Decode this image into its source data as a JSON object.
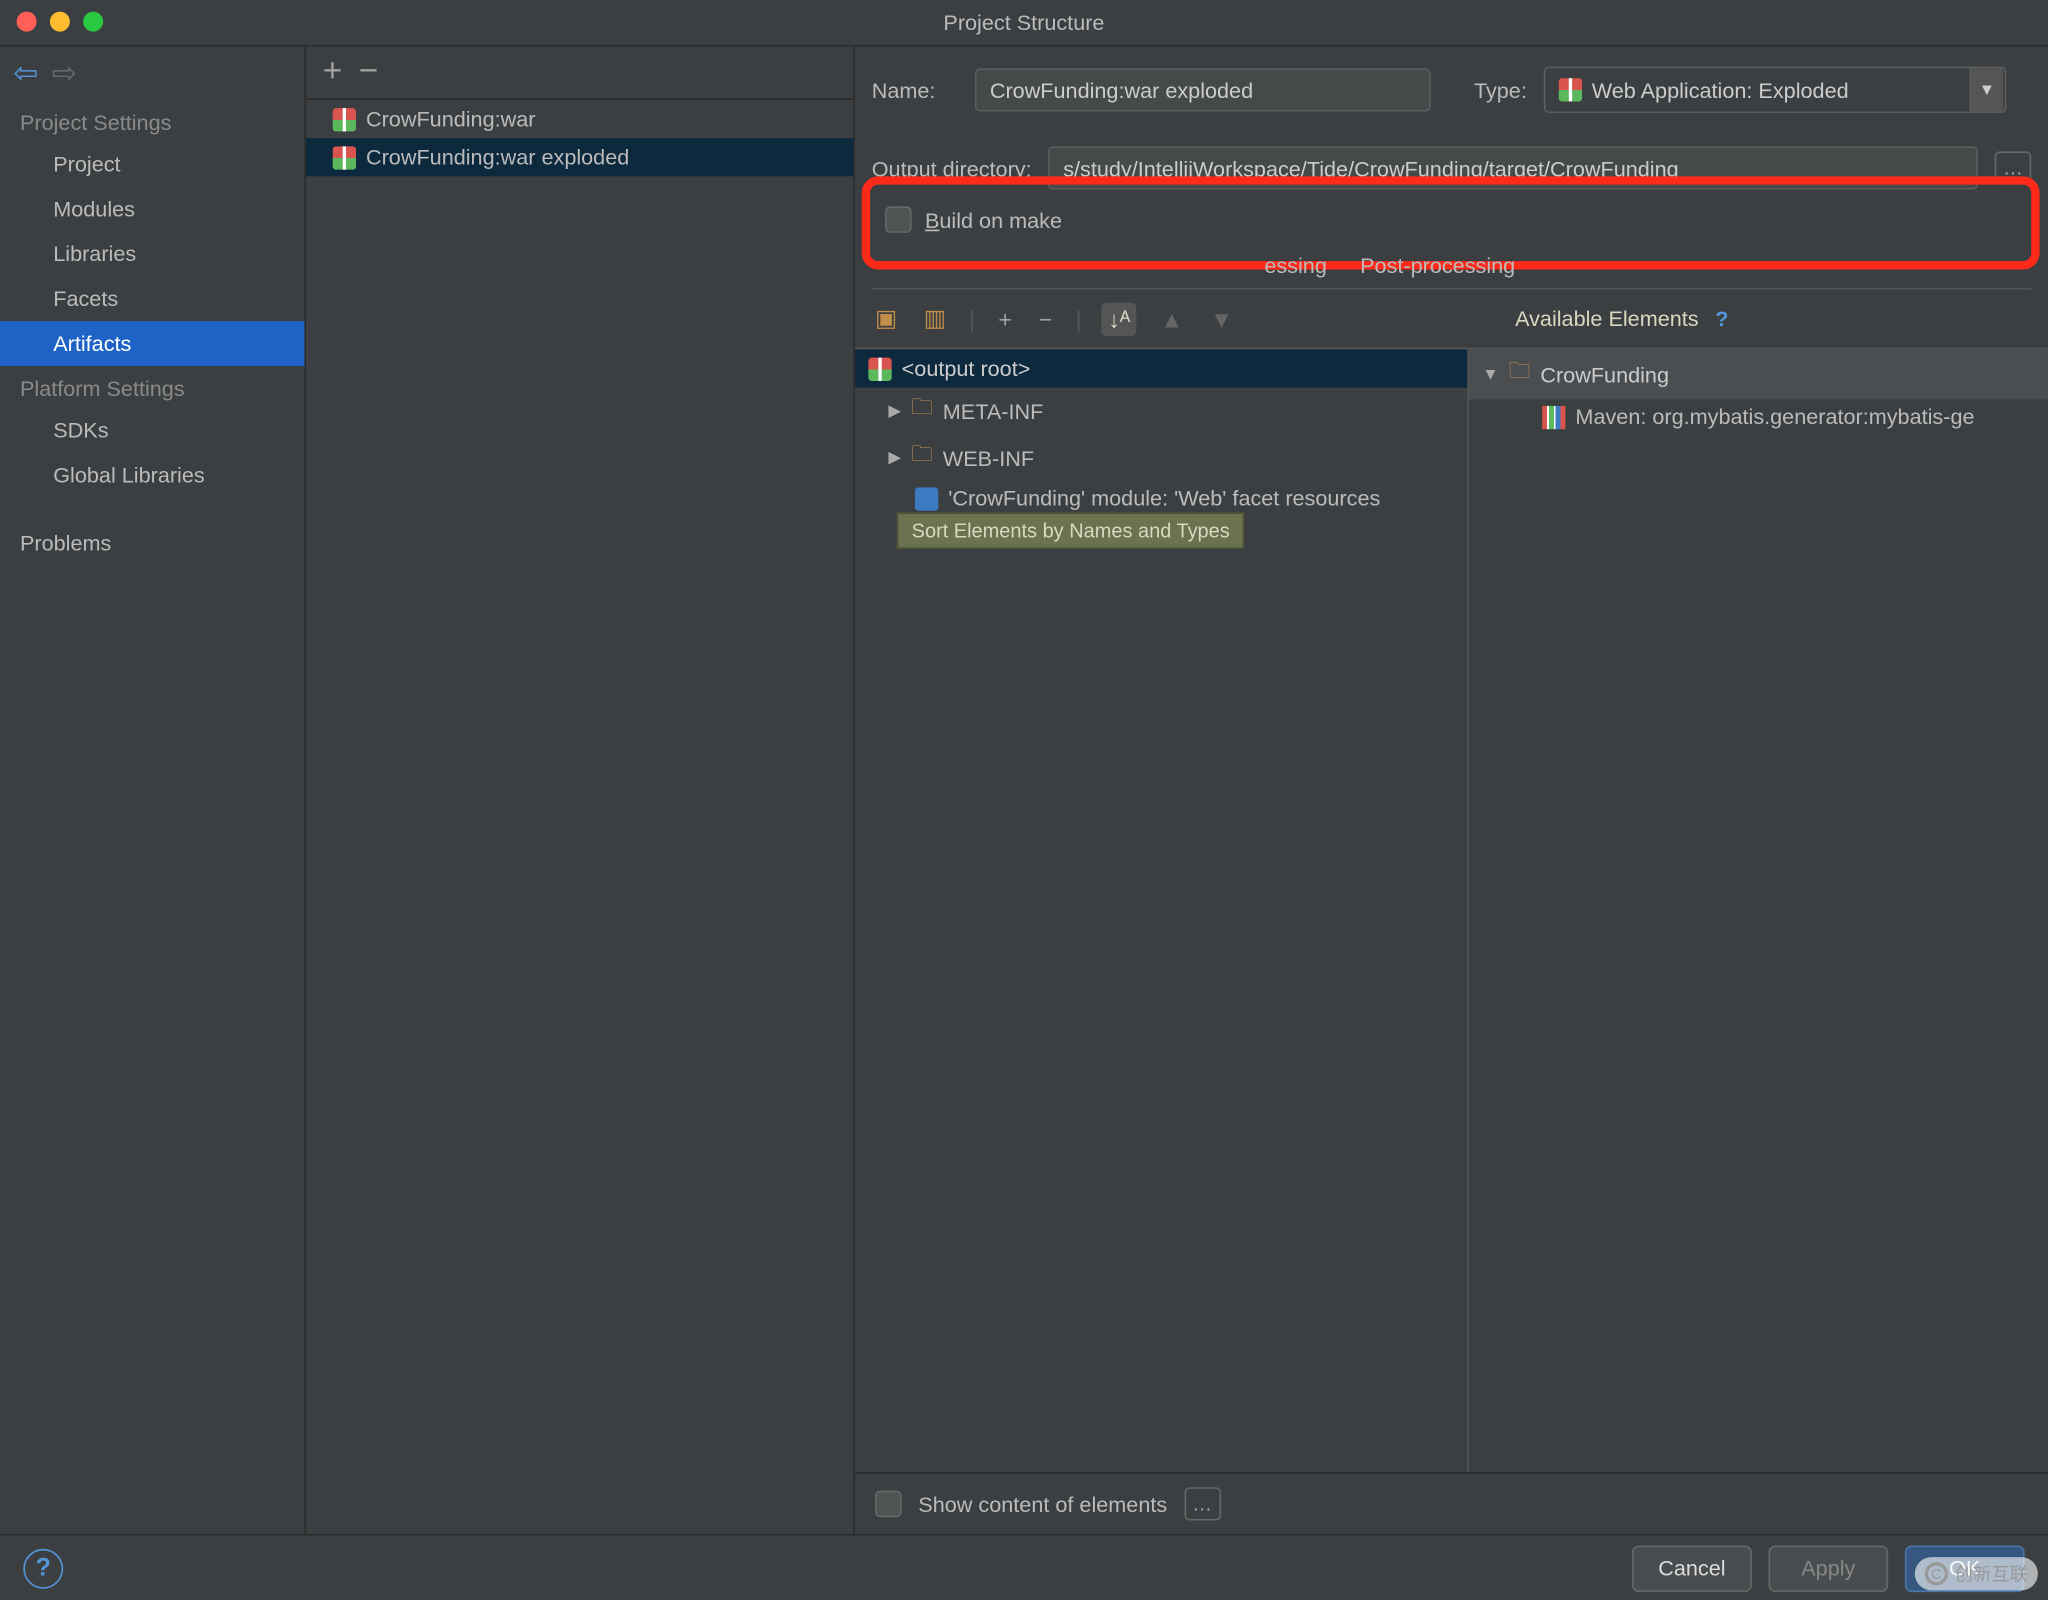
{
  "window": {
    "title": "Project Structure"
  },
  "sidebar": {
    "section1": "Project Settings",
    "section2": "Platform Settings",
    "items": [
      "Project",
      "Modules",
      "Libraries",
      "Facets",
      "Artifacts"
    ],
    "platform_items": [
      "SDKs",
      "Global Libraries"
    ],
    "problems": "Problems",
    "selected": "Artifacts"
  },
  "artifacts": {
    "items": [
      {
        "name": "CrowFunding:war"
      },
      {
        "name": "CrowFunding:war exploded"
      }
    ],
    "selected_index": 1,
    "plus": "+",
    "minus": "−"
  },
  "form": {
    "name_label": "Name:",
    "name_value": "CrowFunding:war exploded",
    "type_label": "Type:",
    "type_value": "Web Application: Exploded",
    "output_label": "Output directory:",
    "output_value": "s/study/IntellijWorkspace/Tide/CrowFunding/target/CrowFunding",
    "build_on_make": "Build on make"
  },
  "tabs": {
    "hidden_suffix": "essing",
    "post": "Post-processing"
  },
  "tooltip": "Sort Elements by Names and Types",
  "layout_toolbar": {
    "plus": "+",
    "minus": "−"
  },
  "output_tree": {
    "root": "<output root>",
    "items": [
      {
        "name": "META-INF",
        "folder": true
      },
      {
        "name": "WEB-INF",
        "folder": true
      },
      {
        "name": "'CrowFunding' module: 'Web' facet resources",
        "folder": false
      }
    ]
  },
  "available": {
    "title": "Available Elements",
    "help": "?",
    "root": "CrowFunding",
    "items": [
      {
        "name": "Maven: org.mybatis.generator:mybatis-ge"
      }
    ]
  },
  "footer": {
    "show_content": "Show content of elements"
  },
  "buttons": {
    "help": "?",
    "cancel": "Cancel",
    "apply": "Apply",
    "ok": "OK"
  },
  "watermark": {
    "text": "创新互联"
  }
}
